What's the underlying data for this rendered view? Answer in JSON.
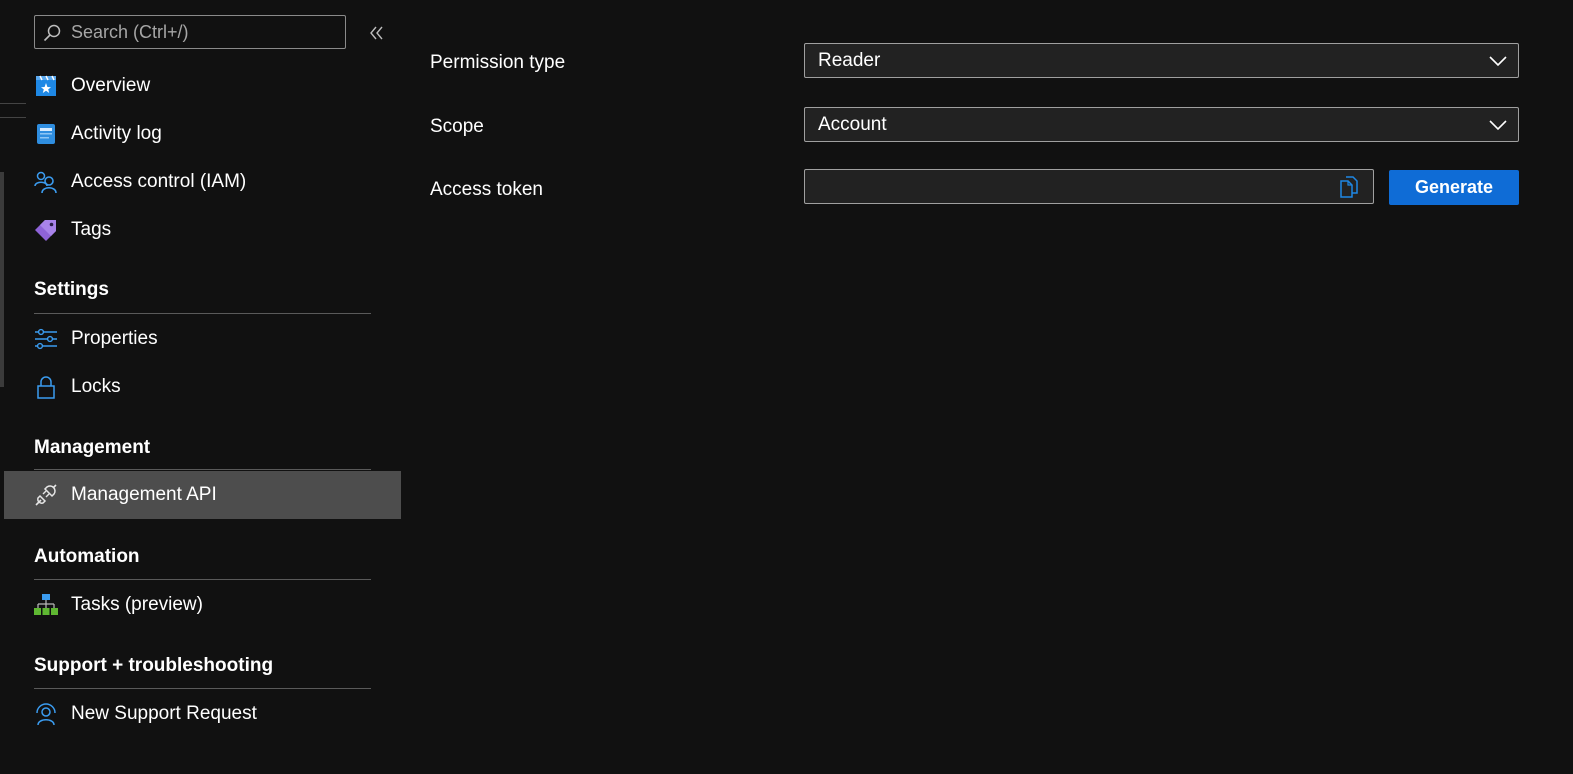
{
  "search": {
    "placeholder": "Search (Ctrl+/)"
  },
  "sidebar": {
    "items": [
      {
        "label": "Overview",
        "icon": "overview-icon"
      },
      {
        "label": "Activity log",
        "icon": "activity-log-icon"
      },
      {
        "label": "Access control (IAM)",
        "icon": "access-control-icon"
      },
      {
        "label": "Tags",
        "icon": "tag-icon"
      }
    ],
    "sections": [
      {
        "title": "Settings",
        "items": [
          {
            "label": "Properties",
            "icon": "sliders-icon"
          },
          {
            "label": "Locks",
            "icon": "lock-icon"
          }
        ]
      },
      {
        "title": "Management",
        "items": [
          {
            "label": "Management API",
            "icon": "plug-icon",
            "active": true
          }
        ]
      },
      {
        "title": "Automation",
        "items": [
          {
            "label": "Tasks (preview)",
            "icon": "hierarchy-icon"
          }
        ]
      },
      {
        "title": "Support + troubleshooting",
        "items": [
          {
            "label": "New Support Request",
            "icon": "support-person-icon"
          }
        ]
      }
    ]
  },
  "form": {
    "permission_type": {
      "label": "Permission type",
      "value": "Reader"
    },
    "scope": {
      "label": "Scope",
      "value": "Account"
    },
    "access_token": {
      "label": "Access token",
      "value": ""
    },
    "generate_label": "Generate"
  },
  "colors": {
    "background": "#111111",
    "active_item": "#4d4d4d",
    "accent_blue": "#0f6cd6",
    "icon_blue": "#1e88e5"
  }
}
